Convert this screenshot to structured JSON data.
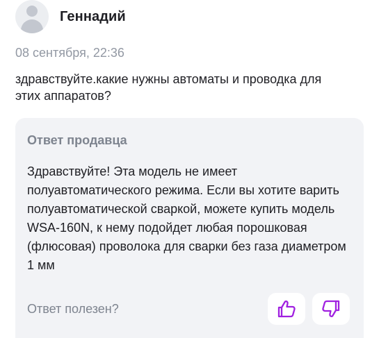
{
  "review": {
    "author": "Геннадий",
    "date": "08 сентября, 22:36",
    "question": "здравствуйте.какие нужны автоматы и проводка для этих аппаратов?"
  },
  "answer": {
    "title": "Ответ продавца",
    "text": "Здравствуйте! Эта модель не имеет полуавтоматического режима. Если вы хотите варить полуавтоматической сваркой, можете купить модель WSA-160N, к нему подойдет любая порошковая (флюсовая) проволока для сварки без газа диаметром 1 мм",
    "helpful_prompt": "Ответ полезен?"
  },
  "icons": {
    "avatar": "user-avatar-placeholder",
    "like": "thumbs-up-icon",
    "dislike": "thumbs-down-icon"
  },
  "colors": {
    "accent": "#a020e0",
    "card_background": "#f2f3f6",
    "muted_text": "#7e848f",
    "date_text": "#9298a3"
  }
}
